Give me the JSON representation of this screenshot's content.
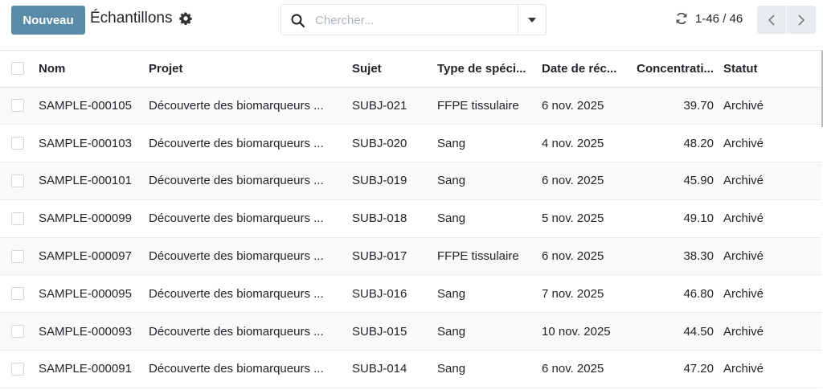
{
  "toolbar": {
    "new_label": "Nouveau",
    "title": "Échantillons"
  },
  "search": {
    "placeholder": "Chercher...",
    "value": ""
  },
  "pager": {
    "value": "1-46 / 46"
  },
  "icons": {
    "settings": "gear-icon",
    "search": "search-icon",
    "search_toggle": "caret-down-icon",
    "refresh": "refresh-icon",
    "previous": "chevron-left-icon",
    "next": "chevron-right-icon"
  },
  "colors": {
    "primary": "#5a8ca8",
    "row_stripe": "#f9f9fa",
    "border": "#dee2e6"
  },
  "table": {
    "columns": [
      "Nom",
      "Projet",
      "Sujet",
      "Type de spéci...",
      "Date de réc...",
      "Concentrati...",
      "Statut"
    ],
    "rows": [
      {
        "name": "SAMPLE-000105",
        "project": "Découverte des biomarqueurs ...",
        "subject": "SUBJ-021",
        "type": "FFPE tissulaire",
        "date": "6 nov. 2025",
        "concentration": "39.70",
        "status": "Archivé"
      },
      {
        "name": "SAMPLE-000103",
        "project": "Découverte des biomarqueurs ...",
        "subject": "SUBJ-020",
        "type": "Sang",
        "date": "4 nov. 2025",
        "concentration": "48.20",
        "status": "Archivé"
      },
      {
        "name": "SAMPLE-000101",
        "project": "Découverte des biomarqueurs ...",
        "subject": "SUBJ-019",
        "type": "Sang",
        "date": "6 nov. 2025",
        "concentration": "45.90",
        "status": "Archivé"
      },
      {
        "name": "SAMPLE-000099",
        "project": "Découverte des biomarqueurs ...",
        "subject": "SUBJ-018",
        "type": "Sang",
        "date": "5 nov. 2025",
        "concentration": "49.10",
        "status": "Archivé"
      },
      {
        "name": "SAMPLE-000097",
        "project": "Découverte des biomarqueurs ...",
        "subject": "SUBJ-017",
        "type": "FFPE tissulaire",
        "date": "6 nov. 2025",
        "concentration": "38.30",
        "status": "Archivé"
      },
      {
        "name": "SAMPLE-000095",
        "project": "Découverte des biomarqueurs ...",
        "subject": "SUBJ-016",
        "type": "Sang",
        "date": "7 nov. 2025",
        "concentration": "46.80",
        "status": "Archivé"
      },
      {
        "name": "SAMPLE-000093",
        "project": "Découverte des biomarqueurs ...",
        "subject": "SUBJ-015",
        "type": "Sang",
        "date": "10 nov. 2025",
        "concentration": "44.50",
        "status": "Archivé"
      },
      {
        "name": "SAMPLE-000091",
        "project": "Découverte des biomarqueurs ...",
        "subject": "SUBJ-014",
        "type": "Sang",
        "date": "6 nov. 2025",
        "concentration": "47.20",
        "status": "Archivé"
      }
    ]
  }
}
